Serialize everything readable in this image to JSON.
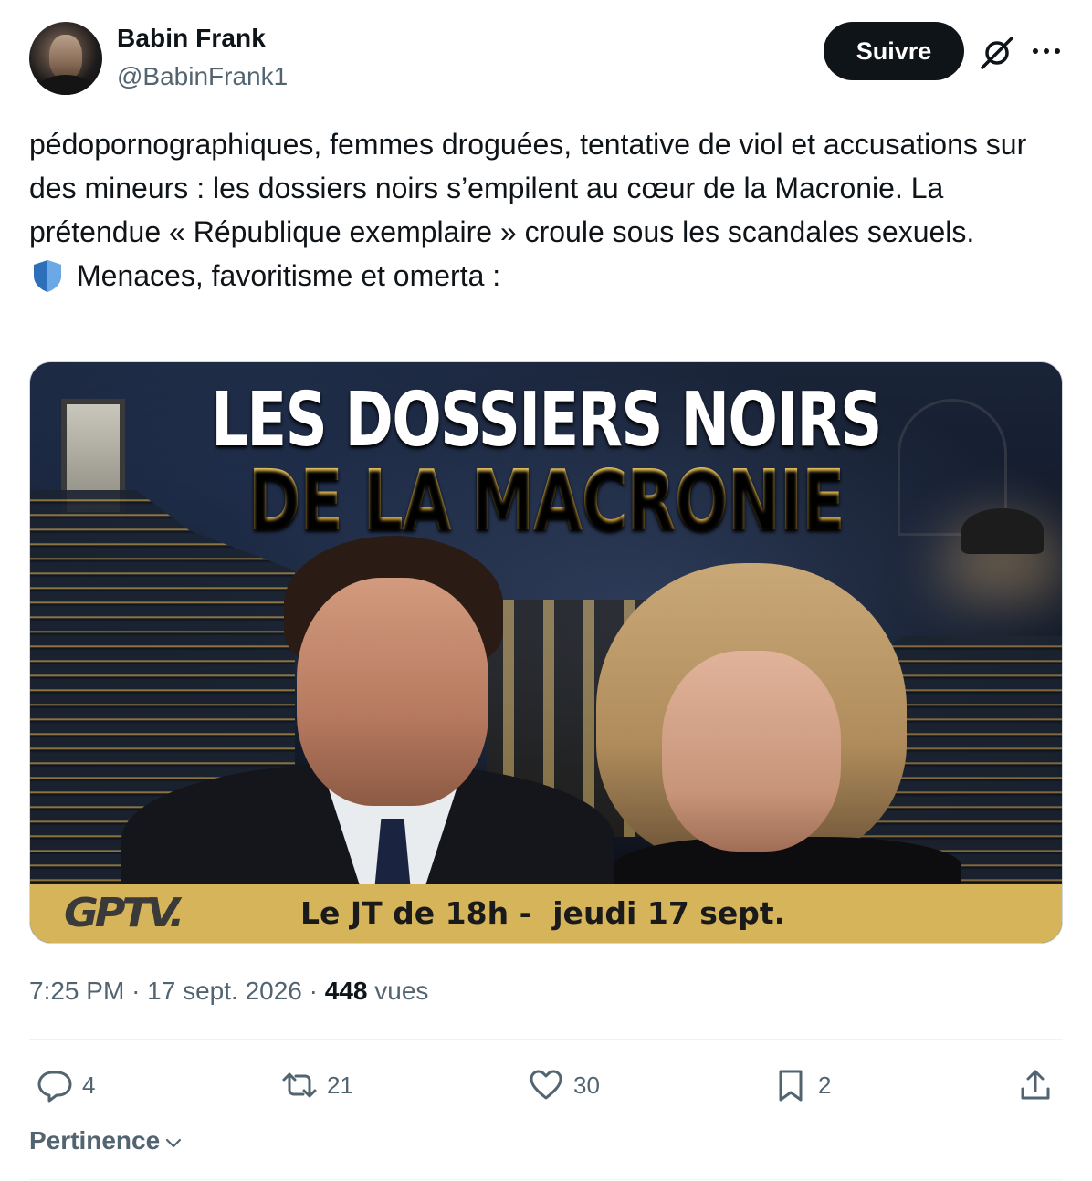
{
  "author": {
    "display_name": "Babin Frank",
    "handle": "@BabinFrank1"
  },
  "follow_label": "Suivre",
  "tweet": {
    "paragraph": "pédopornographiques, femmes droguées, tentative de viol et accusations sur des mineurs : les dossiers noirs s’empilent au cœur de la Macronie. La prétendue « République exemplaire » croule sous les scandales sexuels.",
    "shield_line": "Menaces, favoritisme et omerta :"
  },
  "media": {
    "headline_line1": "LES DOSSIERS NOIRS",
    "headline_line2": "DE LA MACRONIE",
    "logo": "GPTV.",
    "banner_text": "Le JT de 18h -  jeudi 17 sept."
  },
  "meta": {
    "time": "7:25 PM",
    "date": "17 sept. 2026",
    "views_count": "448",
    "views_label": "vues"
  },
  "actions": {
    "replies": "4",
    "reposts": "21",
    "likes": "30",
    "bookmarks": "2"
  },
  "sort_label": "Pertinence",
  "colors": {
    "text": "#0f1419",
    "secondary": "#536471",
    "divider": "#eff3f4",
    "banner": "#d6b45a",
    "headline_gold": "#e0b23a",
    "shield_blue": "#4a90d9"
  },
  "icons": [
    "grok-icon",
    "more-icon",
    "shield-icon",
    "reply-icon",
    "repost-icon",
    "like-icon",
    "bookmark-icon",
    "share-icon",
    "chevron-down-icon"
  ]
}
